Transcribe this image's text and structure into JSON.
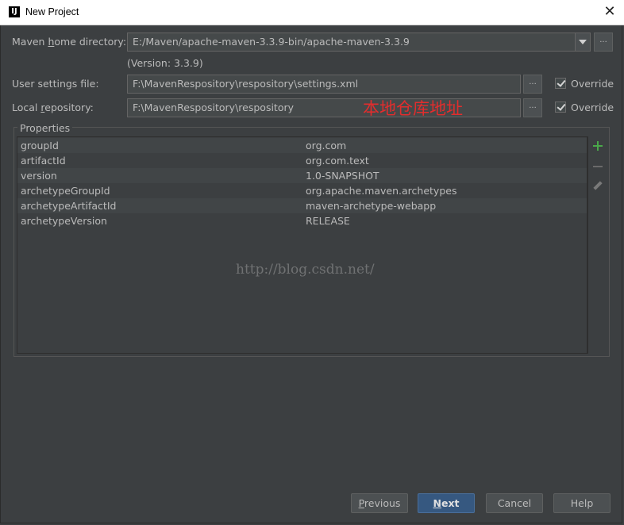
{
  "window": {
    "title": "New Project"
  },
  "form": {
    "maven_home": {
      "label_pre": "Maven ",
      "label_mnemonic": "h",
      "label_post": "ome directory:",
      "value": "E:/Maven/apache-maven-3.3.9-bin/apache-maven-3.3.9",
      "version": "(Version: 3.3.9)"
    },
    "user_settings": {
      "label": "User settings file:",
      "value": "F:\\MavenRespository\\respository\\settings.xml",
      "override_label": "Override",
      "override_checked": true
    },
    "local_repo": {
      "label_pre": "Local ",
      "label_mnemonic": "r",
      "label_post": "epository:",
      "value": "F:\\MavenRespository\\respository",
      "override_label": "Override",
      "override_checked": true
    },
    "browse_label": "..."
  },
  "annotation": "本地仓库地址",
  "properties": {
    "title": "Properties",
    "rows": [
      {
        "key": "groupId",
        "value": "org.com"
      },
      {
        "key": "artifactId",
        "value": "org.com.text"
      },
      {
        "key": "version",
        "value": "1.0-SNAPSHOT"
      },
      {
        "key": "archetypeGroupId",
        "value": "org.apache.maven.archetypes"
      },
      {
        "key": "archetypeArtifactId",
        "value": "maven-archetype-webapp"
      },
      {
        "key": "archetypeVersion",
        "value": "RELEASE"
      }
    ]
  },
  "watermark": "http://blog.csdn.net/",
  "buttons": {
    "previous_mnemonic": "P",
    "previous_rest": "revious",
    "next_mnemonic": "N",
    "next_rest": "ext",
    "cancel": "Cancel",
    "help": "Help"
  },
  "colors": {
    "background": "#3c3f41",
    "annotation": "#e22d2d",
    "primary_button": "#365880",
    "add_icon": "#4aa84a"
  }
}
